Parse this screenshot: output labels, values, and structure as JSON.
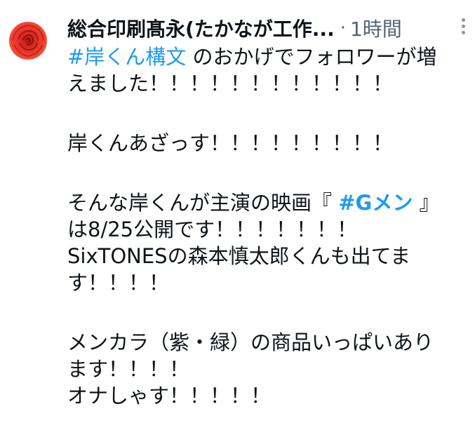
{
  "author": {
    "display_name": "総合印刷髙永(たかなが工作...",
    "separator": "·",
    "timestamp": "1時間",
    "avatar_icon": "red-rose-avatar"
  },
  "colors": {
    "hashtag": "#1d9bf0",
    "text": "#0f1419",
    "meta": "#536471",
    "avatar_rose": "#e8352b"
  },
  "tweet": {
    "line1": {
      "hashtag": "#岸くん構文",
      "text": " のおかげでフォロワーが増"
    },
    "line2": "えました！！！！！！！！！！！！",
    "line4": "岸くんあざっす！！！！！！！！！",
    "line6": {
      "before": "そんな岸くんが主演の映画『 ",
      "hashtag": "#Gメン",
      "after": " 』"
    },
    "line7": "は8/25公開です！！！！！！！",
    "line8": "SixTONESの森本慎太郎くんも出てま",
    "line9": "す！！！！",
    "line11": "メンカラ（紫・緑）の商品いっぱいあり",
    "line12": "ます！！！！",
    "line13": "オナしゃす！！！！！"
  }
}
